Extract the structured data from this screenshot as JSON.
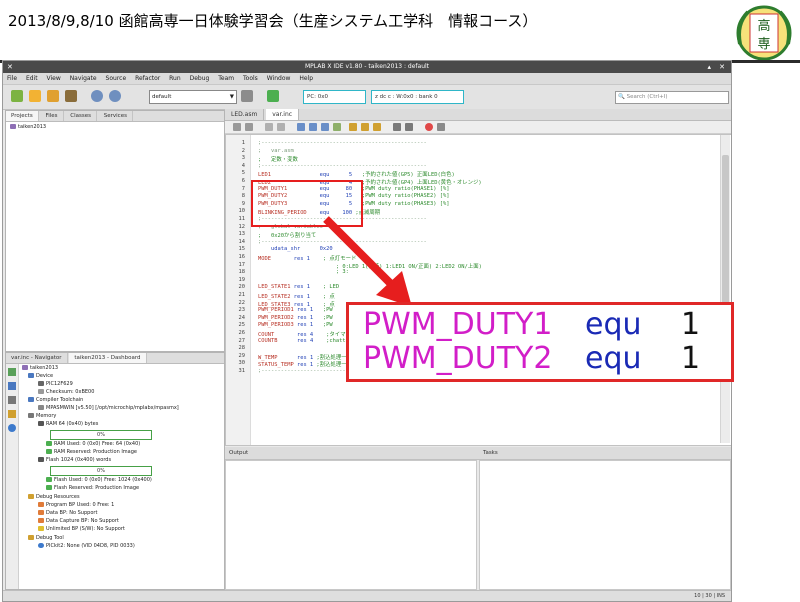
{
  "slide": {
    "title": "2013/8/9,8/10 函館高専一日体験学習会（生産システム工学科　情報コース）",
    "emblem_text": [
      "高",
      "専"
    ]
  },
  "ide": {
    "window_title": "MPLAB X IDE v1.80 - taiken2013 : default",
    "menu": [
      "File",
      "Edit",
      "View",
      "Navigate",
      "Source",
      "Refactor",
      "Run",
      "Debug",
      "Team",
      "Tools",
      "Window",
      "Help"
    ],
    "toolbar": {
      "config_select": "default",
      "pc_field": "PC: 0x0",
      "status_field": "z dc c  : W:0x0 : bank 0",
      "search_placeholder": "Search (Ctrl+I)"
    },
    "projects_panel": {
      "tabs": [
        "Projects",
        "Files",
        "Classes",
        "Services"
      ],
      "tree": [
        "taiken2013"
      ]
    },
    "navigator_panel": {
      "tabs": [
        "var.inc - Navigator",
        "taiken2013 - Dashboard"
      ],
      "items": [
        "taiken2013",
        "Device",
        "PIC12F629",
        "Checksum: 0xBE00",
        "Compiler Toolchain",
        "MPASMWIN [v5.50] [/opt/microchip/mplabx/mpasmx]",
        "Memory",
        "RAM 64 (0x40) bytes",
        "0%",
        "RAM Used: 0 (0x0) Free: 64 (0x40)",
        "RAM Reserved: Production Image",
        "Flash 1024 (0x400) words",
        "0%",
        "Flash Used: 0 (0x0) Free: 1024 (0x400)",
        "Flash Reserved: Production Image",
        "Debug Resources",
        "Program BP Used: 0  Free: 1",
        "Data BP: No Support",
        "Data Capture BP: No Support",
        "Unlimited BP (S/W): No Support",
        "Debug Tool",
        "PICkit2: None (VID 04D8, PID 0033)"
      ]
    },
    "editor": {
      "tabs": [
        "LED.asm",
        "var.inc"
      ],
      "lines": [
        {
          "n": "1",
          "segs": [
            {
              "t": ";---------------------------------------------------",
              "c": "c-com"
            }
          ]
        },
        {
          "n": "2",
          "segs": [
            {
              "t": ";   var.asm",
              "c": "c-com"
            }
          ]
        },
        {
          "n": "3",
          "segs": [
            {
              "t": ";   定数・変数",
              "c": "c-grn"
            }
          ]
        },
        {
          "n": "4",
          "segs": [
            {
              "t": ";---------------------------------------------------",
              "c": "c-com"
            }
          ]
        },
        {
          "n": "5",
          "segs": [
            {
              "t": "LED1",
              "c": "c-id"
            },
            {
              "t": "               equ      5   ",
              "c": "c-dir"
            },
            {
              "t": ";予約された値(GP5) 正面LED(白色)",
              "c": "c-grn"
            }
          ]
        },
        {
          "n": "6",
          "segs": [
            {
              "t": "LED2",
              "c": "c-id"
            },
            {
              "t": "               equ      4   ",
              "c": "c-dir"
            },
            {
              "t": ";予約された値(GP4) 上面LED(黄色・オレンジ)",
              "c": "c-grn"
            }
          ]
        },
        {
          "n": "7",
          "segs": [
            {
              "t": "PWM_DUTY1",
              "c": "c-id"
            },
            {
              "t": "          equ     80   ",
              "c": "c-dir"
            },
            {
              "t": ";PWM duty ratio(PHASE1) [%]",
              "c": "c-grn"
            }
          ]
        },
        {
          "n": "8",
          "segs": [
            {
              "t": "PWM_DUTY2",
              "c": "c-id"
            },
            {
              "t": "          equ     15   ",
              "c": "c-dir"
            },
            {
              "t": ";PWM duty ratio(PHASE2) [%]",
              "c": "c-grn"
            }
          ]
        },
        {
          "n": "9",
          "segs": [
            {
              "t": "PWM_DUTY3",
              "c": "c-id"
            },
            {
              "t": "          equ      5   ",
              "c": "c-dir"
            },
            {
              "t": ";PWM duty ratio(PHASE3) [%]",
              "c": "c-grn"
            }
          ]
        },
        {
          "n": "10",
          "segs": [
            {
              "t": "BLINKING_PERIOD",
              "c": "c-id"
            },
            {
              "t": "    equ    100 ",
              "c": "c-dir"
            },
            {
              "t": ";点滅周期",
              "c": "c-grn"
            }
          ]
        },
        {
          "n": "11",
          "segs": [
            {
              "t": ";---------------------------------------------------",
              "c": "c-com"
            }
          ]
        },
        {
          "n": "12",
          "segs": [
            {
              "t": ";   global variables",
              "c": "c-com"
            }
          ]
        },
        {
          "n": "13",
          "segs": [
            {
              "t": ";   0x20から割り当て",
              "c": "c-grn"
            }
          ]
        },
        {
          "n": "14",
          "segs": [
            {
              "t": ";---------------------------------------------------",
              "c": "c-com"
            }
          ]
        },
        {
          "n": "15",
          "segs": [
            {
              "t": "    udata_shr      0x20",
              "c": "c-dir"
            }
          ]
        },
        {
          "n": "16",
          "segs": [
            {
              "t": "MODE",
              "c": "c-id"
            },
            {
              "t": "       res 1    ",
              "c": "c-dir"
            },
            {
              "t": "; 点灯モード",
              "c": "c-grn"
            }
          ]
        },
        {
          "n": "17",
          "segs": [
            {
              "t": "                        ; 0:LED 1(常時) 1:LED1 ON/正面) 2:LED2 ON/上面)",
              "c": "c-grn"
            }
          ]
        },
        {
          "n": "18",
          "segs": [
            {
              "t": "                        ; 3:",
              "c": "c-grn"
            }
          ]
        },
        {
          "n": "19",
          "segs": [
            {
              "t": "",
              "c": "c-com"
            }
          ]
        },
        {
          "n": "20",
          "segs": [
            {
              "t": "LED_STATE1",
              "c": "c-id"
            },
            {
              "t": " res 1    ",
              "c": "c-dir"
            },
            {
              "t": "; LED",
              "c": "c-grn"
            }
          ]
        },
        {
          "n": "21",
          "segs": [
            {
              "t": "LED_STATE2",
              "c": "c-id"
            },
            {
              "t": " res 1    ",
              "c": "c-dir"
            },
            {
              "t": "; 点",
              "c": "c-grn"
            }
          ]
        },
        {
          "n": "22",
          "segs": [
            {
              "t": "LED_STATE3",
              "c": "c-id"
            },
            {
              "t": " res 1    ",
              "c": "c-dir"
            },
            {
              "t": "; 点",
              "c": "c-grn"
            }
          ]
        },
        {
          "n": "23",
          "segs": [
            {
              "t": "PWM_PERIOD1",
              "c": "c-id"
            },
            {
              "t": " res 1   ",
              "c": "c-dir"
            },
            {
              "t": ";PW",
              "c": "c-grn"
            }
          ]
        },
        {
          "n": "24",
          "segs": [
            {
              "t": "PWM_PERIOD2",
              "c": "c-id"
            },
            {
              "t": " res 1   ",
              "c": "c-dir"
            },
            {
              "t": ";PW",
              "c": "c-grn"
            }
          ]
        },
        {
          "n": "25",
          "segs": [
            {
              "t": "PWM_PERIOD3",
              "c": "c-id"
            },
            {
              "t": " res 1   ",
              "c": "c-dir"
            },
            {
              "t": ";PW",
              "c": "c-grn"
            }
          ]
        },
        {
          "n": "26",
          "segs": [
            {
              "t": "COUNT",
              "c": "c-id"
            },
            {
              "t": "       res 4    ",
              "c": "c-dir"
            },
            {
              "t": ";タイマー用カウンタ",
              "c": "c-grn"
            }
          ]
        },
        {
          "n": "27",
          "segs": [
            {
              "t": "COUNTB",
              "c": "c-id"
            },
            {
              "t": "      res 4    ",
              "c": "c-dir"
            },
            {
              "t": ";chattering counter timer",
              "c": "c-grn"
            }
          ]
        },
        {
          "n": "28",
          "segs": [
            {
              "t": "",
              "c": "c-com"
            }
          ]
        },
        {
          "n": "29",
          "segs": [
            {
              "t": "W_TEMP",
              "c": "c-id"
            },
            {
              "t": "      res 1 ",
              "c": "c-dir"
            },
            {
              "t": ";割込処理一時記憶",
              "c": "c-grn"
            }
          ]
        },
        {
          "n": "30",
          "segs": [
            {
              "t": "STATUS_TEMP",
              "c": "c-id"
            },
            {
              "t": " res 1 ",
              "c": "c-dir"
            },
            {
              "t": ";割込処理一時記憶",
              "c": "c-grn"
            }
          ]
        },
        {
          "n": "31",
          "segs": [
            {
              "t": ";---------------------------------------------------",
              "c": "c-com"
            }
          ]
        }
      ]
    },
    "output_tabs": [
      "Output",
      "Tasks"
    ],
    "status_position": "10 | 30 | INS"
  },
  "callout": {
    "lines": [
      {
        "name": "PWM_DUTY1",
        "directive": "equ",
        "value": "1"
      },
      {
        "name": "PWM_DUTY2",
        "directive": "equ",
        "value": "1"
      }
    ],
    "colors": {
      "box": "#e02828",
      "name": "#d21ec8",
      "directive": "#1a2ab5"
    }
  }
}
